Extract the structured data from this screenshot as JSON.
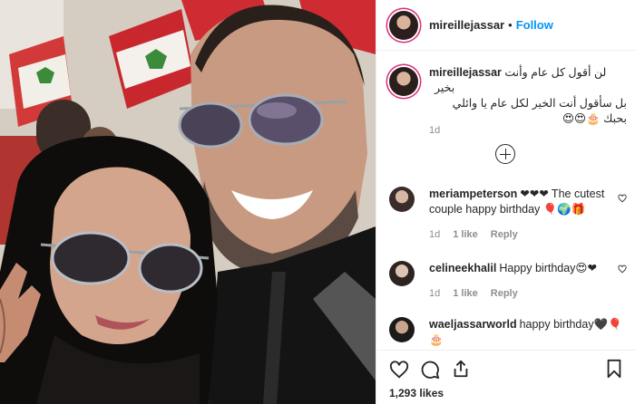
{
  "header": {
    "username": "mireillejassar",
    "separator": "•",
    "follow_label": "Follow"
  },
  "caption": {
    "username": "mireillejassar",
    "line1": "لن أقول كل عام وأنت بخير",
    "line2": "بل سأقول أنت الخير لكل عام يا وائلي",
    "line3": "بحبك 🎂😍😍",
    "time": "1d"
  },
  "comments": [
    {
      "username": "meriampeterson",
      "text": "❤❤❤ The cutest couple happy birthday 🎈🌍🎁",
      "time": "1d",
      "likes": "1 like",
      "reply": "Reply"
    },
    {
      "username": "celineekhalil",
      "text": "Happy birthday😍❤",
      "time": "1d",
      "likes": "1 like",
      "reply": "Reply"
    },
    {
      "username": "waeljassarworld",
      "text": "happy birthday🖤🎈🎂",
      "time": "",
      "likes": "",
      "reply": ""
    }
  ],
  "footer": {
    "likes_count": "1,293 likes"
  },
  "icons": [
    "heart-icon",
    "comment-icon",
    "share-icon",
    "bookmark-icon",
    "add-comment-icon"
  ]
}
